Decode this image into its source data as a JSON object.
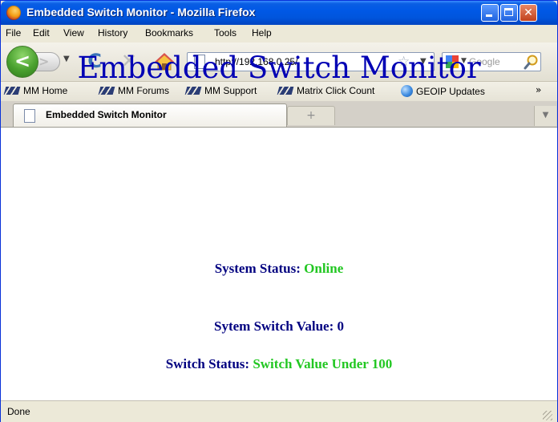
{
  "window": {
    "title": "Embedded Switch Monitor - Mozilla Firefox"
  },
  "menu": [
    "File",
    "Edit",
    "View",
    "History",
    "Bookmarks",
    "Tools",
    "Help"
  ],
  "address_bar": {
    "url": "http://192.168.0.25/"
  },
  "search": {
    "placeholder": "Google"
  },
  "bookmarks": [
    "MM Home",
    "MM Forums",
    "MM Support",
    "Matrix Click Count",
    "GEOIP Updates"
  ],
  "bookmarks_overflow": "»",
  "tab": {
    "label": "Embedded Switch Monitor",
    "new_tab_glyph": "+"
  },
  "page": {
    "title": "Embedded Switch Monitor",
    "system_status_label": "System Status: ",
    "system_status_value": "Online",
    "switch_value_label": "Sytem Switch Value: ",
    "switch_value": "0",
    "switch_status_label": "Switch Status: ",
    "switch_status_value": "Switch Value Under 100"
  },
  "status_bar": {
    "text": "Done"
  },
  "colors": {
    "title_blue": "#0000b4",
    "label_navy": "#000080",
    "status_green": "#22c722"
  },
  "icons": [
    "firefox-logo-icon",
    "back-arrow-icon",
    "forward-arrow-icon",
    "reload-icon",
    "stop-icon",
    "home-icon",
    "page-favicon-icon",
    "bookmark-star-icon",
    "google-logo-icon",
    "magnifier-icon",
    "globe-icon",
    "resize-grip-icon"
  ]
}
